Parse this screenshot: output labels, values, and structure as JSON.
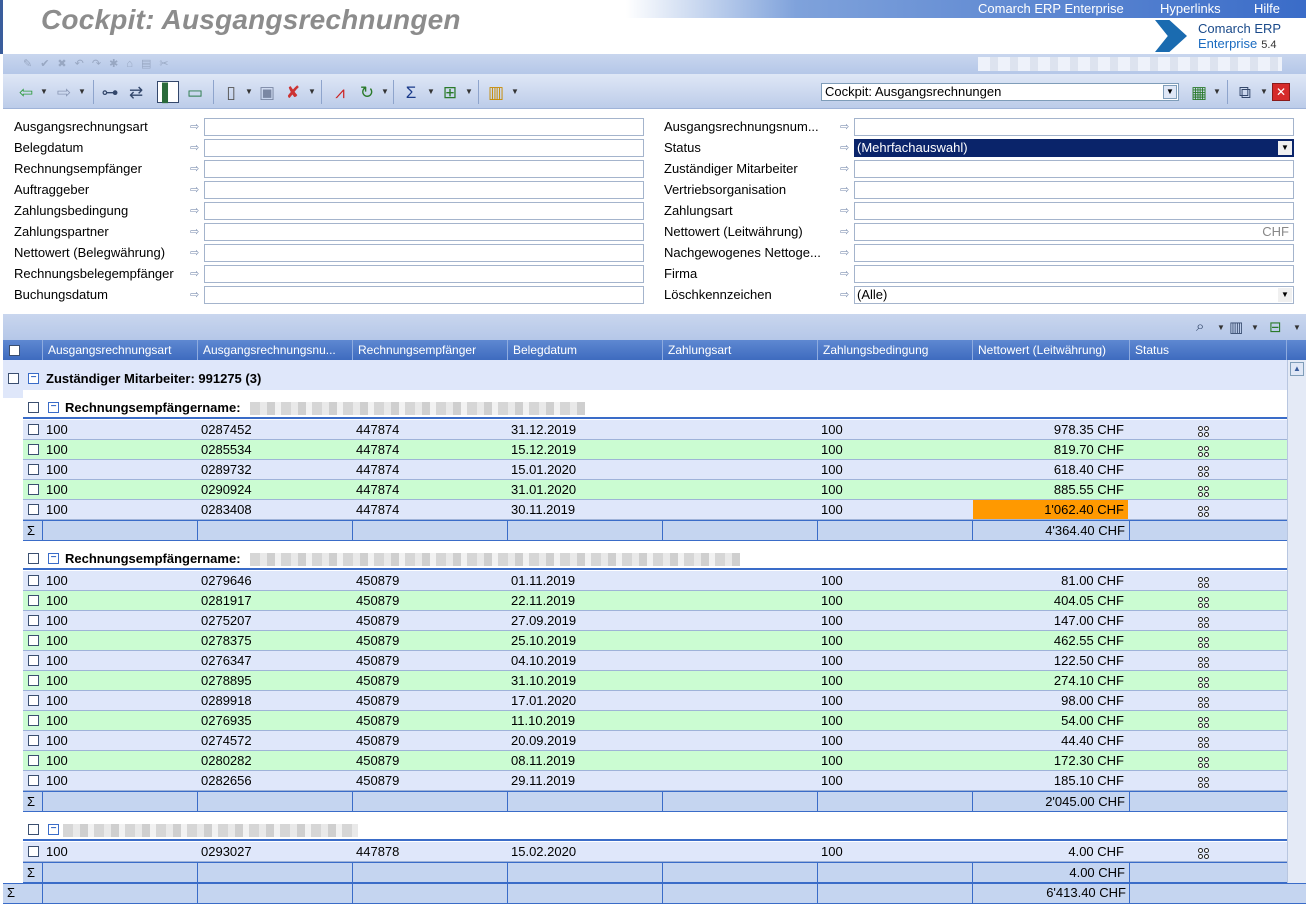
{
  "window": {
    "title": "Cockpit: Ausgangsrechnungen",
    "menu": [
      "Comarch ERP Enterprise",
      "Hyperlinks",
      "Hilfe"
    ],
    "logo_line1": "Comarch ERP",
    "logo_line2": "Enterprise",
    "logo_version": "5.4"
  },
  "toolbar": {
    "cockpit_select": "Cockpit: Ausgangsrechnungen",
    "icons": [
      "back-arrow-icon",
      "forward-arrow-icon",
      "search-binoculars-icon",
      "transfer-icon",
      "panel-toggle-icon",
      "screen-icon",
      "new-document-icon",
      "save-icon",
      "delete-document-icon",
      "chart-check-icon",
      "refresh-icon",
      "sum-icon",
      "export-icon",
      "report-icon",
      "calculator-icon",
      "layout-icon",
      "close-icon"
    ]
  },
  "filters": {
    "left": [
      {
        "label": "Ausgangsrechnungsart",
        "value": ""
      },
      {
        "label": "Belegdatum",
        "value": ""
      },
      {
        "label": "Rechnungsempfänger",
        "value": ""
      },
      {
        "label": "Auftraggeber",
        "value": ""
      },
      {
        "label": "Zahlungsbedingung",
        "value": ""
      },
      {
        "label": "Zahlungspartner",
        "value": ""
      },
      {
        "label": "Nettowert (Belegwährung)",
        "value": ""
      },
      {
        "label": "Rechnungsbelegempfänger",
        "value": ""
      },
      {
        "label": "Buchungsdatum",
        "value": ""
      }
    ],
    "right": [
      {
        "label": "Ausgangsrechnungsnum...",
        "value": ""
      },
      {
        "label": "Status",
        "value": "(Mehrfachauswahl)"
      },
      {
        "label": "Zuständiger Mitarbeiter",
        "value": ""
      },
      {
        "label": "Vertriebsorganisation",
        "value": ""
      },
      {
        "label": "Zahlungsart",
        "value": ""
      },
      {
        "label": "Nettowert (Leitwährung)",
        "value": "",
        "suffix": "CHF"
      },
      {
        "label": "Nachgewogenes Nettoge...",
        "value": ""
      },
      {
        "label": "Firma",
        "value": ""
      },
      {
        "label": "Löschkennzeichen",
        "value": "(Alle)"
      }
    ]
  },
  "grid": {
    "columns": [
      "Ausgangsrechnungsart",
      "Ausgangsrechnungsnu...",
      "Rechnungsempfänger",
      "Belegdatum",
      "Zahlungsart",
      "Zahlungsbedingung",
      "Nettowert (Leitwährung)",
      "Status"
    ],
    "group_label": "Zuständiger Mitarbeiter: 991275  (3)",
    "sum_symbol": "Σ",
    "subgroups": [
      {
        "label": "Rechnungsempfängername:",
        "rows": [
          {
            "art": "100",
            "nr": "0287452",
            "emp": "447874",
            "datum": "31.12.2019",
            "zart": "",
            "bed": "100",
            "wert": "978.35 CHF",
            "hl": false
          },
          {
            "art": "100",
            "nr": "0285534",
            "emp": "447874",
            "datum": "15.12.2019",
            "zart": "",
            "bed": "100",
            "wert": "819.70 CHF",
            "hl": false
          },
          {
            "art": "100",
            "nr": "0289732",
            "emp": "447874",
            "datum": "15.01.2020",
            "zart": "",
            "bed": "100",
            "wert": "618.40 CHF",
            "hl": false
          },
          {
            "art": "100",
            "nr": "0290924",
            "emp": "447874",
            "datum": "31.01.2020",
            "zart": "",
            "bed": "100",
            "wert": "885.55 CHF",
            "hl": false
          },
          {
            "art": "100",
            "nr": "0283408",
            "emp": "447874",
            "datum": "30.11.2019",
            "zart": "",
            "bed": "100",
            "wert": "1'062.40 CHF",
            "hl": true
          }
        ],
        "total": "4'364.40 CHF"
      },
      {
        "label": "Rechnungsempfängername:",
        "rows": [
          {
            "art": "100",
            "nr": "0279646",
            "emp": "450879",
            "datum": "01.11.2019",
            "zart": "",
            "bed": "100",
            "wert": "81.00 CHF",
            "hl": false
          },
          {
            "art": "100",
            "nr": "0281917",
            "emp": "450879",
            "datum": "22.11.2019",
            "zart": "",
            "bed": "100",
            "wert": "404.05 CHF",
            "hl": false
          },
          {
            "art": "100",
            "nr": "0275207",
            "emp": "450879",
            "datum": "27.09.2019",
            "zart": "",
            "bed": "100",
            "wert": "147.00 CHF",
            "hl": false
          },
          {
            "art": "100",
            "nr": "0278375",
            "emp": "450879",
            "datum": "25.10.2019",
            "zart": "",
            "bed": "100",
            "wert": "462.55 CHF",
            "hl": false
          },
          {
            "art": "100",
            "nr": "0276347",
            "emp": "450879",
            "datum": "04.10.2019",
            "zart": "",
            "bed": "100",
            "wert": "122.50 CHF",
            "hl": false
          },
          {
            "art": "100",
            "nr": "0278895",
            "emp": "450879",
            "datum": "31.10.2019",
            "zart": "",
            "bed": "100",
            "wert": "274.10 CHF",
            "hl": false
          },
          {
            "art": "100",
            "nr": "0289918",
            "emp": "450879",
            "datum": "17.01.2020",
            "zart": "",
            "bed": "100",
            "wert": "98.00 CHF",
            "hl": false
          },
          {
            "art": "100",
            "nr": "0276935",
            "emp": "450879",
            "datum": "11.10.2019",
            "zart": "",
            "bed": "100",
            "wert": "54.00 CHF",
            "hl": false
          },
          {
            "art": "100",
            "nr": "0274572",
            "emp": "450879",
            "datum": "20.09.2019",
            "zart": "",
            "bed": "100",
            "wert": "44.40 CHF",
            "hl": false
          },
          {
            "art": "100",
            "nr": "0280282",
            "emp": "450879",
            "datum": "08.11.2019",
            "zart": "",
            "bed": "100",
            "wert": "172.30 CHF",
            "hl": false
          },
          {
            "art": "100",
            "nr": "0282656",
            "emp": "450879",
            "datum": "29.11.2019",
            "zart": "",
            "bed": "100",
            "wert": "185.10 CHF",
            "hl": false
          }
        ],
        "total": "2'045.00 CHF"
      },
      {
        "label": "",
        "rows": [
          {
            "art": "100",
            "nr": "0293027",
            "emp": "447878",
            "datum": "15.02.2020",
            "zart": "",
            "bed": "100",
            "wert": "4.00 CHF",
            "hl": false
          }
        ],
        "total": "4.00 CHF"
      }
    ],
    "grand_total": "6'413.40 CHF"
  }
}
